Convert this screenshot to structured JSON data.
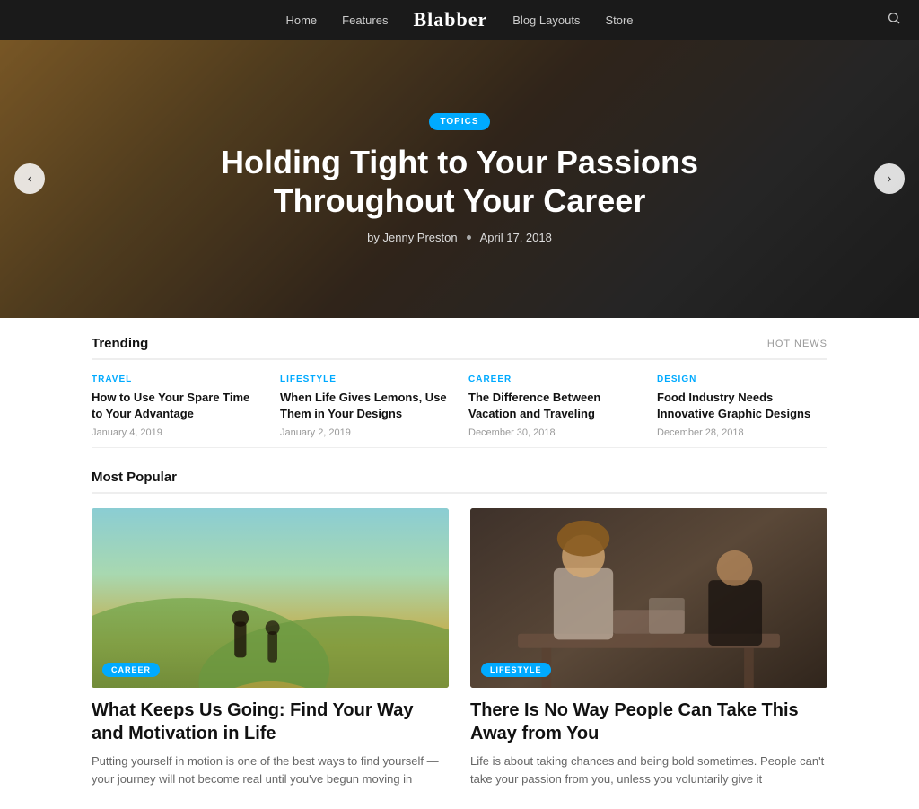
{
  "nav": {
    "links": [
      {
        "label": "Home",
        "id": "home"
      },
      {
        "label": "Features",
        "id": "features"
      },
      {
        "label": "Blabber",
        "id": "brand"
      },
      {
        "label": "Blog Layouts",
        "id": "blog-layouts"
      },
      {
        "label": "Store",
        "id": "store"
      }
    ],
    "brand": "Blabber"
  },
  "hero": {
    "tag": "TOPICS",
    "title": "Holding Tight to Your Passions Throughout Your Career",
    "author": "by Jenny Preston",
    "date": "April 17, 2018",
    "prev_arrow": "‹",
    "next_arrow": "›"
  },
  "trending": {
    "section_title": "Trending",
    "hot_news_label": "HOT NEWS",
    "items": [
      {
        "category": "TRAVEL",
        "title": "How to Use Your Spare Time to Your Advantage",
        "date": "January 4, 2019"
      },
      {
        "category": "LIFESTYLE",
        "title": "When Life Gives Lemons, Use Them in Your Designs",
        "date": "January 2, 2019"
      },
      {
        "category": "CAREER",
        "title": "The Difference Between Vacation and Traveling",
        "date": "December 30, 2018"
      },
      {
        "category": "DESIGN",
        "title": "Food Industry Needs Innovative Graphic Designs",
        "date": "December 28, 2018"
      }
    ]
  },
  "popular": {
    "section_title": "Most Popular",
    "cards": [
      {
        "tag": "CAREER",
        "title": "What Keeps Us Going: Find Your Way and Motivation in Life",
        "excerpt": "Putting yourself in motion is one of the best ways to find yourself — your journey will not become real until you've begun moving in",
        "image_type": "running"
      },
      {
        "tag": "LIFESTYLE",
        "title": "There Is No Way People Can Take This Away from You",
        "excerpt": "Life is about taking chances and being bold sometimes. People can't take your passion from you, unless you voluntarily give it",
        "image_type": "workshop"
      }
    ]
  }
}
